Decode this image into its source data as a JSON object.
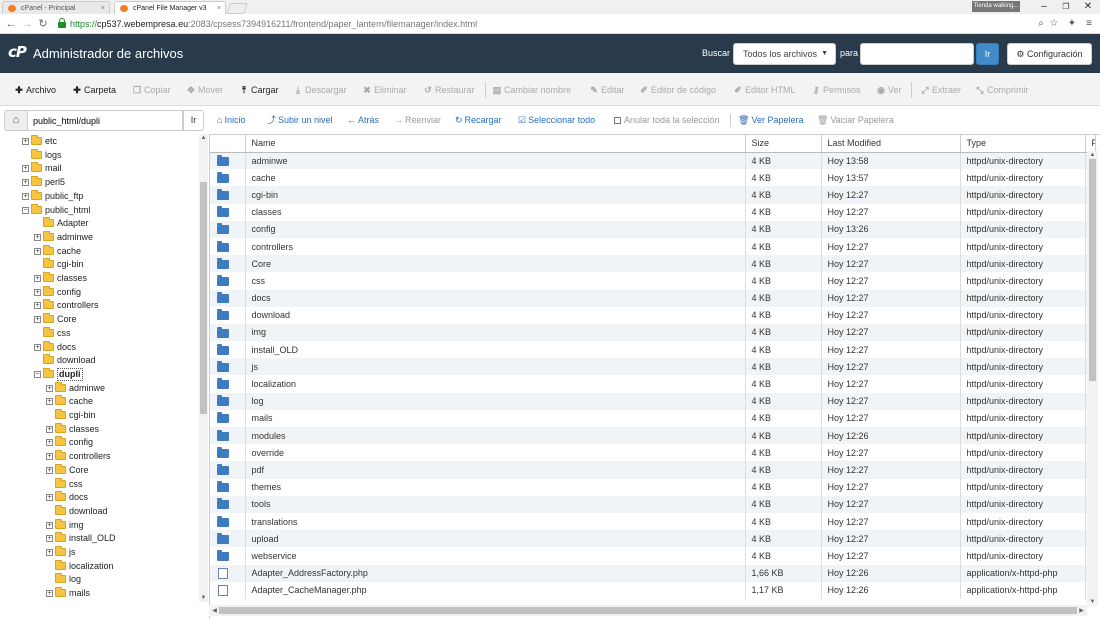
{
  "browser": {
    "tabs": [
      {
        "title": "cPanel - Principal"
      },
      {
        "title": "cPanel File Manager v3"
      }
    ],
    "profile_label": "Tienda walking...",
    "url": {
      "protocol": "https://",
      "host": "cp537.webempresa.eu",
      "path": ":2083/cpsess7394916211/frontend/paper_lantern/filemanager/index.html"
    }
  },
  "header": {
    "logo": "cP",
    "title": "Administrador de archivos",
    "search_label": "Buscar",
    "scope_selected": "Todos los archivos",
    "para_label": "para",
    "search_value": "",
    "go_label": "Ir",
    "settings_label": "Configuración"
  },
  "toolbar": [
    {
      "label": "Archivo",
      "icon": "plus-icon",
      "enabled": true
    },
    {
      "label": "Carpeta",
      "icon": "plus-icon",
      "enabled": true
    },
    {
      "label": "Copiar",
      "icon": "copy-icon",
      "enabled": false
    },
    {
      "label": "Mover",
      "icon": "move-icon",
      "enabled": false
    },
    {
      "label": "Cargar",
      "icon": "upload-icon",
      "enabled": true
    },
    {
      "label": "Descargar",
      "icon": "download-icon",
      "enabled": false
    },
    {
      "label": "Eliminar",
      "icon": "times-icon",
      "enabled": false
    },
    {
      "label": "Restaurar",
      "icon": "undo-icon",
      "enabled": false
    },
    {
      "label": "Cambiar nombre",
      "icon": "file-icon",
      "enabled": false
    },
    {
      "label": "Editar",
      "icon": "pencil-icon",
      "enabled": false
    },
    {
      "label": "Editor de código",
      "icon": "edit-icon",
      "enabled": false
    },
    {
      "label": "Editor HTML",
      "icon": "edit-icon",
      "enabled": false
    },
    {
      "label": "Permisos",
      "icon": "key-icon",
      "enabled": false
    },
    {
      "label": "Ver",
      "icon": "eye-icon",
      "enabled": false
    },
    {
      "label": "Extraer",
      "icon": "expand-icon",
      "enabled": false
    },
    {
      "label": "Comprimir",
      "icon": "compress-icon",
      "enabled": false
    }
  ],
  "path_bar": {
    "path_value": "public_html/dupli",
    "go_label": "Ir"
  },
  "tree": [
    {
      "label": "etc",
      "depth": 1,
      "expandable": true,
      "open": false
    },
    {
      "label": "logs",
      "depth": 1,
      "expandable": false,
      "open": false
    },
    {
      "label": "mail",
      "depth": 1,
      "expandable": true,
      "open": false
    },
    {
      "label": "perl5",
      "depth": 1,
      "expandable": true,
      "open": false
    },
    {
      "label": "public_ftp",
      "depth": 1,
      "expandable": true,
      "open": false
    },
    {
      "label": "public_html",
      "depth": 1,
      "expandable": true,
      "open": true
    },
    {
      "label": "Adapter",
      "depth": 2,
      "expandable": false,
      "open": false
    },
    {
      "label": "adminwe",
      "depth": 2,
      "expandable": true,
      "open": false
    },
    {
      "label": "cache",
      "depth": 2,
      "expandable": true,
      "open": false
    },
    {
      "label": "cgi-bin",
      "depth": 2,
      "expandable": false,
      "open": false
    },
    {
      "label": "classes",
      "depth": 2,
      "expandable": true,
      "open": false
    },
    {
      "label": "config",
      "depth": 2,
      "expandable": true,
      "open": false
    },
    {
      "label": "controllers",
      "depth": 2,
      "expandable": true,
      "open": false
    },
    {
      "label": "Core",
      "depth": 2,
      "expandable": true,
      "open": false
    },
    {
      "label": "css",
      "depth": 2,
      "expandable": false,
      "open": false
    },
    {
      "label": "docs",
      "depth": 2,
      "expandable": true,
      "open": false
    },
    {
      "label": "download",
      "depth": 2,
      "expandable": false,
      "open": false
    },
    {
      "label": "dupli",
      "depth": 2,
      "expandable": true,
      "open": true,
      "selected": true
    },
    {
      "label": "adminwe",
      "depth": 3,
      "expandable": true,
      "open": false
    },
    {
      "label": "cache",
      "depth": 3,
      "expandable": true,
      "open": false
    },
    {
      "label": "cgi-bin",
      "depth": 3,
      "expandable": false,
      "open": false
    },
    {
      "label": "classes",
      "depth": 3,
      "expandable": true,
      "open": false
    },
    {
      "label": "config",
      "depth": 3,
      "expandable": true,
      "open": false
    },
    {
      "label": "controllers",
      "depth": 3,
      "expandable": true,
      "open": false
    },
    {
      "label": "Core",
      "depth": 3,
      "expandable": true,
      "open": false
    },
    {
      "label": "css",
      "depth": 3,
      "expandable": false,
      "open": false
    },
    {
      "label": "docs",
      "depth": 3,
      "expandable": true,
      "open": false
    },
    {
      "label": "download",
      "depth": 3,
      "expandable": false,
      "open": false
    },
    {
      "label": "img",
      "depth": 3,
      "expandable": true,
      "open": false
    },
    {
      "label": "install_OLD",
      "depth": 3,
      "expandable": true,
      "open": false
    },
    {
      "label": "js",
      "depth": 3,
      "expandable": true,
      "open": false
    },
    {
      "label": "localization",
      "depth": 3,
      "expandable": false,
      "open": false
    },
    {
      "label": "log",
      "depth": 3,
      "expandable": false,
      "open": false
    },
    {
      "label": "mails",
      "depth": 3,
      "expandable": true,
      "open": false
    }
  ],
  "nav": [
    {
      "label": "Inicio",
      "icon": "home-icon",
      "enabled": true
    },
    {
      "label": "Subir un nivel",
      "icon": "level-up-icon",
      "enabled": true
    },
    {
      "label": "Atrás",
      "icon": "arrow-left-icon",
      "enabled": true
    },
    {
      "label": "Reenviar",
      "icon": "arrow-right-icon",
      "enabled": false
    },
    {
      "label": "Recargar",
      "icon": "refresh-icon",
      "enabled": true
    },
    {
      "label": "Seleccionar todo",
      "icon": "check-square-icon",
      "enabled": true
    },
    {
      "label": "Anular toda la selección",
      "icon": "square-icon",
      "enabled": false
    },
    {
      "label": "Ver Papelera",
      "icon": "trash-icon",
      "enabled": true
    },
    {
      "label": "Vaciar Papelera",
      "icon": "trash-icon",
      "enabled": false
    }
  ],
  "table": {
    "columns": [
      "",
      "Name",
      "Size",
      "Last Modified",
      "Type",
      "P"
    ],
    "rows": [
      {
        "icon": "folder",
        "name": "adminwe",
        "size": "4 KB",
        "modified": "Hoy 13:58",
        "type": "httpd/unix-directory"
      },
      {
        "icon": "folder",
        "name": "cache",
        "size": "4 KB",
        "modified": "Hoy 13:57",
        "type": "httpd/unix-directory"
      },
      {
        "icon": "folder",
        "name": "cgi-bin",
        "size": "4 KB",
        "modified": "Hoy 12:27",
        "type": "httpd/unix-directory"
      },
      {
        "icon": "folder",
        "name": "classes",
        "size": "4 KB",
        "modified": "Hoy 12:27",
        "type": "httpd/unix-directory"
      },
      {
        "icon": "folder",
        "name": "config",
        "size": "4 KB",
        "modified": "Hoy 13:26",
        "type": "httpd/unix-directory"
      },
      {
        "icon": "folder",
        "name": "controllers",
        "size": "4 KB",
        "modified": "Hoy 12:27",
        "type": "httpd/unix-directory"
      },
      {
        "icon": "folder",
        "name": "Core",
        "size": "4 KB",
        "modified": "Hoy 12:27",
        "type": "httpd/unix-directory"
      },
      {
        "icon": "folder",
        "name": "css",
        "size": "4 KB",
        "modified": "Hoy 12:27",
        "type": "httpd/unix-directory"
      },
      {
        "icon": "folder",
        "name": "docs",
        "size": "4 KB",
        "modified": "Hoy 12:27",
        "type": "httpd/unix-directory"
      },
      {
        "icon": "folder",
        "name": "download",
        "size": "4 KB",
        "modified": "Hoy 12:27",
        "type": "httpd/unix-directory"
      },
      {
        "icon": "folder",
        "name": "img",
        "size": "4 KB",
        "modified": "Hoy 12:27",
        "type": "httpd/unix-directory"
      },
      {
        "icon": "folder",
        "name": "install_OLD",
        "size": "4 KB",
        "modified": "Hoy 12:27",
        "type": "httpd/unix-directory"
      },
      {
        "icon": "folder",
        "name": "js",
        "size": "4 KB",
        "modified": "Hoy 12:27",
        "type": "httpd/unix-directory"
      },
      {
        "icon": "folder",
        "name": "localization",
        "size": "4 KB",
        "modified": "Hoy 12:27",
        "type": "httpd/unix-directory"
      },
      {
        "icon": "folder",
        "name": "log",
        "size": "4 KB",
        "modified": "Hoy 12:27",
        "type": "httpd/unix-directory"
      },
      {
        "icon": "folder",
        "name": "mails",
        "size": "4 KB",
        "modified": "Hoy 12:27",
        "type": "httpd/unix-directory"
      },
      {
        "icon": "folder",
        "name": "modules",
        "size": "4 KB",
        "modified": "Hoy 12:26",
        "type": "httpd/unix-directory"
      },
      {
        "icon": "folder",
        "name": "override",
        "size": "4 KB",
        "modified": "Hoy 12:27",
        "type": "httpd/unix-directory"
      },
      {
        "icon": "folder",
        "name": "pdf",
        "size": "4 KB",
        "modified": "Hoy 12:27",
        "type": "httpd/unix-directory"
      },
      {
        "icon": "folder",
        "name": "themes",
        "size": "4 KB",
        "modified": "Hoy 12:27",
        "type": "httpd/unix-directory"
      },
      {
        "icon": "folder",
        "name": "tools",
        "size": "4 KB",
        "modified": "Hoy 12:27",
        "type": "httpd/unix-directory"
      },
      {
        "icon": "folder",
        "name": "translations",
        "size": "4 KB",
        "modified": "Hoy 12:27",
        "type": "httpd/unix-directory"
      },
      {
        "icon": "folder",
        "name": "upload",
        "size": "4 KB",
        "modified": "Hoy 12:27",
        "type": "httpd/unix-directory"
      },
      {
        "icon": "folder",
        "name": "webservice",
        "size": "4 KB",
        "modified": "Hoy 12:27",
        "type": "httpd/unix-directory"
      },
      {
        "icon": "php",
        "name": "Adapter_AddressFactory.php",
        "size": "1,66 KB",
        "modified": "Hoy 12:26",
        "type": "application/x-httpd-php"
      },
      {
        "icon": "php",
        "name": "Adapter_CacheManager.php",
        "size": "1,17 KB",
        "modified": "Hoy 12:26",
        "type": "application/x-httpd-php"
      }
    ]
  },
  "colors": {
    "header_bg": "#293a4a",
    "link_blue": "#2a6ebb",
    "row_stripe": "#f1f4f6",
    "folder_tree": "#f5c542",
    "folder_table": "#3f7cbf"
  }
}
